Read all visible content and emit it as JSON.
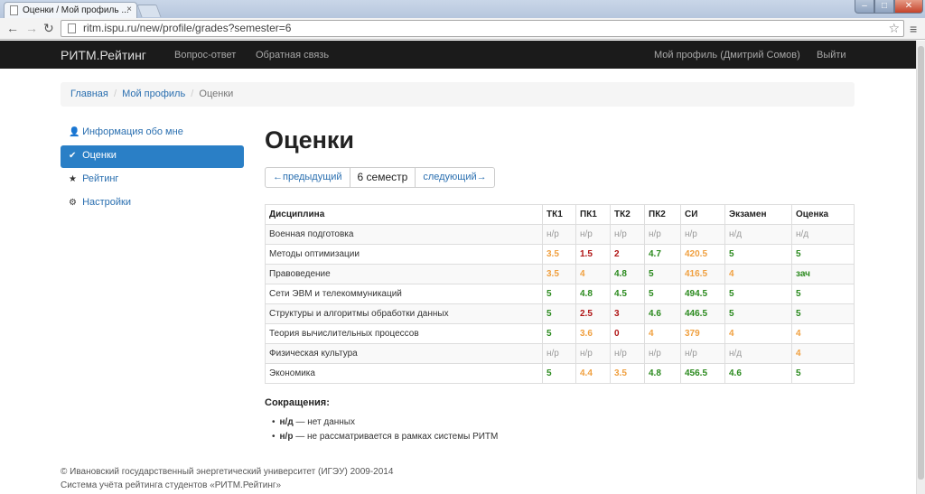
{
  "browser": {
    "tab_title": "Оценки / Мой профиль ...",
    "tab_close": "×",
    "url": "ritm.ispu.ru/new/profile/grades?semester=6",
    "back": "←",
    "forward": "→",
    "reload": "↻",
    "star": "☆",
    "menu": "≡",
    "win_min": "–",
    "win_max": "□",
    "win_close": "✕"
  },
  "navbar": {
    "brand": "РИТМ.Рейтинг",
    "links": [
      "Вопрос-ответ",
      "Обратная связь"
    ],
    "profile": "Мой профиль (Дмитрий Сомов)",
    "logout": "Выйти"
  },
  "breadcrumb": {
    "items": [
      "Главная",
      "Мой профиль"
    ],
    "separator": "/",
    "active": "Оценки"
  },
  "sidebar": {
    "items": [
      {
        "label": "Информация обо мне",
        "icon": "user-icon",
        "glyph": "👤"
      },
      {
        "label": "Оценки",
        "icon": "check-icon",
        "glyph": "✔"
      },
      {
        "label": "Рейтинг",
        "icon": "star-icon",
        "glyph": "★"
      },
      {
        "label": "Настройки",
        "icon": "gear-icon",
        "glyph": "⚙"
      }
    ],
    "active_index": 1
  },
  "main": {
    "title": "Оценки",
    "pager": {
      "prev": "←предыдущий",
      "current": "6 семестр",
      "next": "следующий→"
    }
  },
  "table": {
    "headers": [
      "Дисциплина",
      "ТК1",
      "ПК1",
      "ТК2",
      "ПК2",
      "СИ",
      "Экзамен",
      "Оценка"
    ],
    "rows": [
      {
        "name": "Военная подготовка",
        "cells": [
          [
            "н/р",
            "grey"
          ],
          [
            "н/р",
            "grey"
          ],
          [
            "н/р",
            "grey"
          ],
          [
            "н/р",
            "grey"
          ],
          [
            "н/р",
            "grey"
          ],
          [
            "н/д",
            "grey"
          ],
          [
            "н/д",
            "grey"
          ]
        ]
      },
      {
        "name": "Методы оптимизации",
        "cells": [
          [
            "3.5",
            "orange"
          ],
          [
            "1.5",
            "red"
          ],
          [
            "2",
            "red"
          ],
          [
            "4.7",
            "green"
          ],
          [
            "420.5",
            "orange"
          ],
          [
            "5",
            "green"
          ],
          [
            "5",
            "green"
          ]
        ]
      },
      {
        "name": "Правоведение",
        "cells": [
          [
            "3.5",
            "orange"
          ],
          [
            "4",
            "orange"
          ],
          [
            "4.8",
            "green"
          ],
          [
            "5",
            "green"
          ],
          [
            "416.5",
            "orange"
          ],
          [
            "4",
            "orange"
          ],
          [
            "зач",
            "green"
          ]
        ]
      },
      {
        "name": "Сети ЭВМ и телекоммуникаций",
        "cells": [
          [
            "5",
            "green"
          ],
          [
            "4.8",
            "green"
          ],
          [
            "4.5",
            "green"
          ],
          [
            "5",
            "green"
          ],
          [
            "494.5",
            "green"
          ],
          [
            "5",
            "green"
          ],
          [
            "5",
            "green"
          ]
        ]
      },
      {
        "name": "Структуры и алгоритмы обработки данных",
        "cells": [
          [
            "5",
            "green"
          ],
          [
            "2.5",
            "red"
          ],
          [
            "3",
            "red"
          ],
          [
            "4.6",
            "green"
          ],
          [
            "446.5",
            "green"
          ],
          [
            "5",
            "green"
          ],
          [
            "5",
            "green"
          ]
        ]
      },
      {
        "name": "Теория вычислительных процессов",
        "cells": [
          [
            "5",
            "green"
          ],
          [
            "3.6",
            "orange"
          ],
          [
            "0",
            "red"
          ],
          [
            "4",
            "orange"
          ],
          [
            "379",
            "orange"
          ],
          [
            "4",
            "orange"
          ],
          [
            "4",
            "orange"
          ]
        ]
      },
      {
        "name": "Физическая культура",
        "cells": [
          [
            "н/р",
            "grey"
          ],
          [
            "н/р",
            "grey"
          ],
          [
            "н/р",
            "grey"
          ],
          [
            "н/р",
            "grey"
          ],
          [
            "н/р",
            "grey"
          ],
          [
            "н/д",
            "grey"
          ],
          [
            "4",
            "orange"
          ]
        ]
      },
      {
        "name": "Экономика",
        "cells": [
          [
            "5",
            "green"
          ],
          [
            "4.4",
            "orange"
          ],
          [
            "3.5",
            "orange"
          ],
          [
            "4.8",
            "green"
          ],
          [
            "456.5",
            "green"
          ],
          [
            "4.6",
            "green"
          ],
          [
            "5",
            "green"
          ]
        ]
      }
    ]
  },
  "abbreviations": {
    "title": "Сокращения:",
    "items": [
      {
        "term": "н/д",
        "desc": " — нет данных"
      },
      {
        "term": "н/р",
        "desc": " — не рассматривается в рамках системы РИТМ"
      }
    ]
  },
  "footer": {
    "line1": "© Ивановский государственный энергетический университет (ИГЭУ) 2009-2014",
    "line2": "Система учёта рейтинга студентов «РИТМ.Рейтинг»"
  },
  "colors": {
    "green": "#2b8a1e",
    "orange": "#f0a040",
    "red": "#b01515",
    "grey": "#999999",
    "accent": "#2a7fc6"
  }
}
